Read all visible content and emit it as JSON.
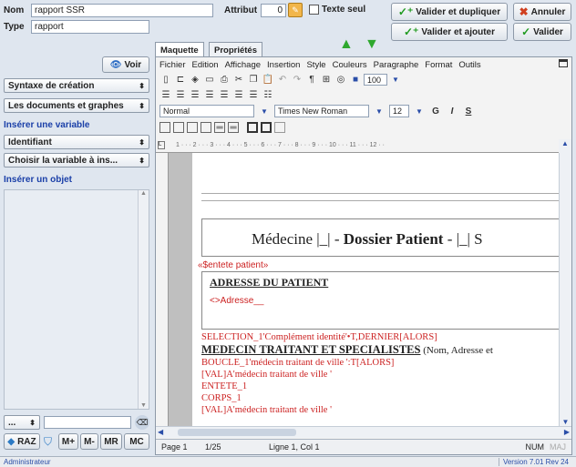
{
  "header": {
    "nom_label": "Nom",
    "nom_value": "rapport SSR",
    "type_label": "Type",
    "type_value": "rapport",
    "attribut_label": "Attribut",
    "attribut_value": "0",
    "texte_seul_label": "Texte seul",
    "valider_dupliquer": "Valider et dupliquer",
    "annuler": "Annuler",
    "valider_ajouter": "Valider et ajouter",
    "valider": "Valider"
  },
  "tabs": {
    "maquette": "Maquette",
    "proprietes": "Propriétés"
  },
  "sidebar": {
    "voir": "Voir",
    "syntaxe": "Syntaxe de création",
    "documents": "Les documents et graphes",
    "inserer_variable": "Insérer une variable",
    "identifiant": "Identifiant",
    "choisir_variable": "Choisir la variable à ins...",
    "inserer_objet": "Insérer un objet",
    "small_select": "...",
    "raz": "RAZ",
    "mplus": "M+",
    "mminus": "M-",
    "mr": "MR",
    "mc": "MC"
  },
  "menu": [
    "Fichier",
    "Edition",
    "Affichage",
    "Insertion",
    "Style",
    "Couleurs",
    "Paragraphe",
    "Format",
    "Outils"
  ],
  "format": {
    "style": "Normal",
    "font": "Times New Roman",
    "size": "12",
    "zoom": "100",
    "bold": "G",
    "italic": "I",
    "underline": "S"
  },
  "ruler_marks": "1 · · · 2 · · · 3 · · · 4 · · · 5 · · · 6 · · · 7 · · · 8 · · · 9 · · · 10 · · · 11 · · · 12 · ·",
  "document": {
    "title_pre": "Médecine |_| - ",
    "title_bold": "Dossier Patient",
    "title_post": " - |_| S",
    "entete": "«$entete patient»",
    "adresse_heading": "ADRESSE DU PATIENT",
    "adresse_value": "<>Adresse__",
    "selection": "SELECTION_1'Complément identité'•T,DERNIER[ALORS]",
    "medecin_heading": "MEDECIN TRAITANT ET SPECIALISTES",
    "medecin_suffix": " (Nom, Adresse et",
    "boucle": "BOUCLE_1'médecin traitant de ville ':T[ALORS]",
    "val1": "[VAL]A'médecin traitant de ville '",
    "entete1": "ENTETE_1",
    "corps1": "CORPS_1",
    "val2": "[VAL]A'médecin traitant de ville '"
  },
  "status": {
    "page": "Page 1",
    "pages": "1/25",
    "ligne": "Ligne 1, Col 1",
    "num": "NUM",
    "maj": "MAJ"
  },
  "footer": {
    "user": "Administrateur",
    "version": "Version 7.01 Rev 24"
  }
}
